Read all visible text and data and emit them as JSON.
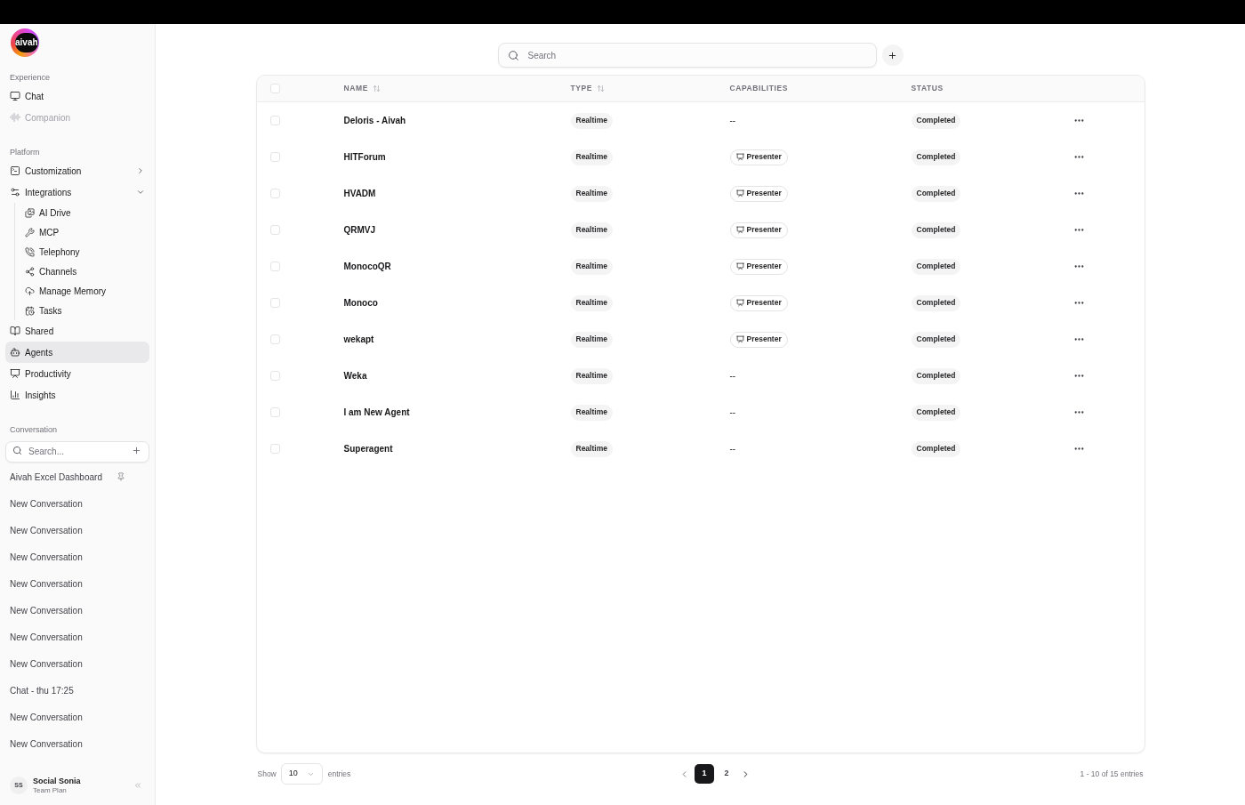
{
  "logo": {
    "text": "aivah"
  },
  "sidebar": {
    "sections": [
      {
        "label": "Experience",
        "items": [
          {
            "label": "Chat",
            "selected": false,
            "disabled": false
          },
          {
            "label": "Companion",
            "selected": false,
            "disabled": true
          }
        ]
      },
      {
        "label": "Platform",
        "items": [
          {
            "label": "Customization",
            "selected": false,
            "disabled": false,
            "expanded": false
          },
          {
            "label": "Integrations",
            "selected": false,
            "disabled": false,
            "expanded": true,
            "children": [
              {
                "label": "AI Drive",
                "selected": false
              },
              {
                "label": "MCP",
                "selected": false
              },
              {
                "label": "Telephony",
                "selected": false
              },
              {
                "label": "Channels",
                "selected": false
              },
              {
                "label": "Manage Memory",
                "selected": false
              },
              {
                "label": "Tasks",
                "selected": false
              }
            ]
          },
          {
            "label": "Shared",
            "selected": false,
            "disabled": false
          },
          {
            "label": "Agents",
            "selected": true,
            "disabled": false
          },
          {
            "label": "Productivity",
            "selected": false,
            "disabled": false
          },
          {
            "label": "Insights",
            "selected": false,
            "disabled": false
          }
        ]
      }
    ],
    "conversation": {
      "label": "Conversation",
      "search": {
        "placeholder": "Search..."
      },
      "items": [
        {
          "title": "Aivah Excel Dashboard",
          "pinned": true
        },
        {
          "title": "New Conversation",
          "pinned": false
        },
        {
          "title": "New Conversation",
          "pinned": false
        },
        {
          "title": "New Conversation",
          "pinned": false
        },
        {
          "title": "New Conversation",
          "pinned": false
        },
        {
          "title": "New Conversation",
          "pinned": false
        },
        {
          "title": "New Conversation",
          "pinned": false
        },
        {
          "title": "New Conversation",
          "pinned": false
        },
        {
          "title": "Chat - thu 17:25",
          "pinned": false
        },
        {
          "title": "New Conversation",
          "pinned": false
        },
        {
          "title": "New Conversation",
          "pinned": false
        }
      ]
    },
    "user": {
      "initials": "SS",
      "name": "Social Sonia",
      "plan": "Team Plan"
    }
  },
  "search": {
    "placeholder": "Search"
  },
  "table": {
    "select_all": {
      "checked": false
    },
    "columns": [
      {
        "label": "NAME",
        "sortable": true
      },
      {
        "label": "TYPE",
        "sortable": true
      },
      {
        "label": "CAPABILITIES",
        "sortable": false
      },
      {
        "label": "STATUS",
        "sortable": false
      }
    ],
    "rows": [
      {
        "checked": false,
        "name": "Deloris - Aivah",
        "type": "Realtime",
        "capability": {
          "kind": "none",
          "text": "--"
        },
        "status": "Completed"
      },
      {
        "checked": false,
        "name": "HITForum",
        "type": "Realtime",
        "capability": {
          "kind": "badge",
          "text": "Presenter"
        },
        "status": "Completed"
      },
      {
        "checked": false,
        "name": "HVADM",
        "type": "Realtime",
        "capability": {
          "kind": "badge",
          "text": "Presenter"
        },
        "status": "Completed"
      },
      {
        "checked": false,
        "name": "QRMVJ",
        "type": "Realtime",
        "capability": {
          "kind": "badge",
          "text": "Presenter"
        },
        "status": "Completed"
      },
      {
        "checked": false,
        "name": "MonocoQR",
        "type": "Realtime",
        "capability": {
          "kind": "badge",
          "text": "Presenter"
        },
        "status": "Completed"
      },
      {
        "checked": false,
        "name": "Monoco",
        "type": "Realtime",
        "capability": {
          "kind": "badge",
          "text": "Presenter"
        },
        "status": "Completed"
      },
      {
        "checked": false,
        "name": "wekapt",
        "type": "Realtime",
        "capability": {
          "kind": "badge",
          "text": "Presenter"
        },
        "status": "Completed"
      },
      {
        "checked": false,
        "name": "Weka",
        "type": "Realtime",
        "capability": {
          "kind": "none",
          "text": "--"
        },
        "status": "Completed"
      },
      {
        "checked": false,
        "name": "I am New Agent",
        "type": "Realtime",
        "capability": {
          "kind": "none",
          "text": "--"
        },
        "status": "Completed"
      },
      {
        "checked": false,
        "name": "Superagent",
        "type": "Realtime",
        "capability": {
          "kind": "none",
          "text": "--"
        },
        "status": "Completed"
      }
    ]
  },
  "pagination": {
    "show_label": "Show",
    "page_size": "10",
    "entries_label": "entries",
    "pages": [
      {
        "label": "1",
        "selected": true
      },
      {
        "label": "2",
        "selected": false
      }
    ],
    "summary": "1 - 10 of 15 entries"
  }
}
